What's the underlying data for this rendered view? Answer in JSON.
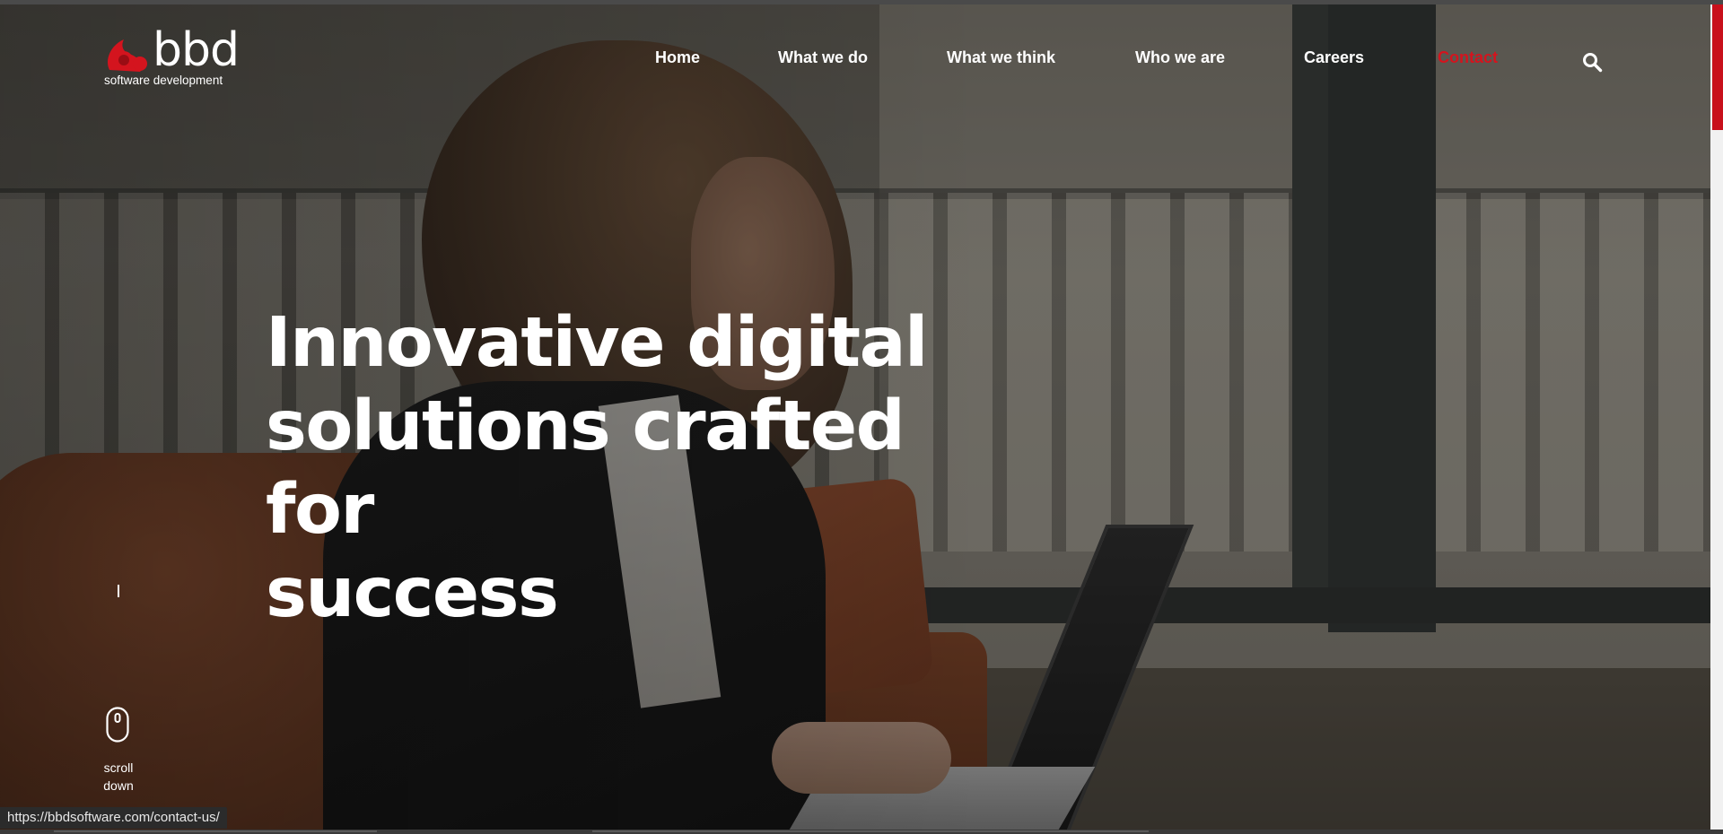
{
  "brand": {
    "wordmark": "bbd",
    "tagline": "software development",
    "accent_color": "#d4141e"
  },
  "nav": {
    "items": [
      {
        "label": "Home"
      },
      {
        "label": "What we do"
      },
      {
        "label": "What we think"
      },
      {
        "label": "Who we are"
      },
      {
        "label": "Careers"
      },
      {
        "label": "Contact",
        "active": true
      }
    ],
    "search_icon": "search-icon"
  },
  "hero": {
    "heading_line1": "Innovative digital",
    "heading_line2": "solutions crafted for",
    "heading_line3": "success",
    "background": "photo of a woman working on a laptop beside an orange sofa"
  },
  "scroll_indicator": {
    "icon": "mouse-icon",
    "label_line1": "scroll",
    "label_line2": "down"
  },
  "status_bar": {
    "url": "https://bbdsoftware.com/contact-us/"
  },
  "scrollbar": {
    "thumb_color": "#c8101b",
    "position": 0.0
  }
}
